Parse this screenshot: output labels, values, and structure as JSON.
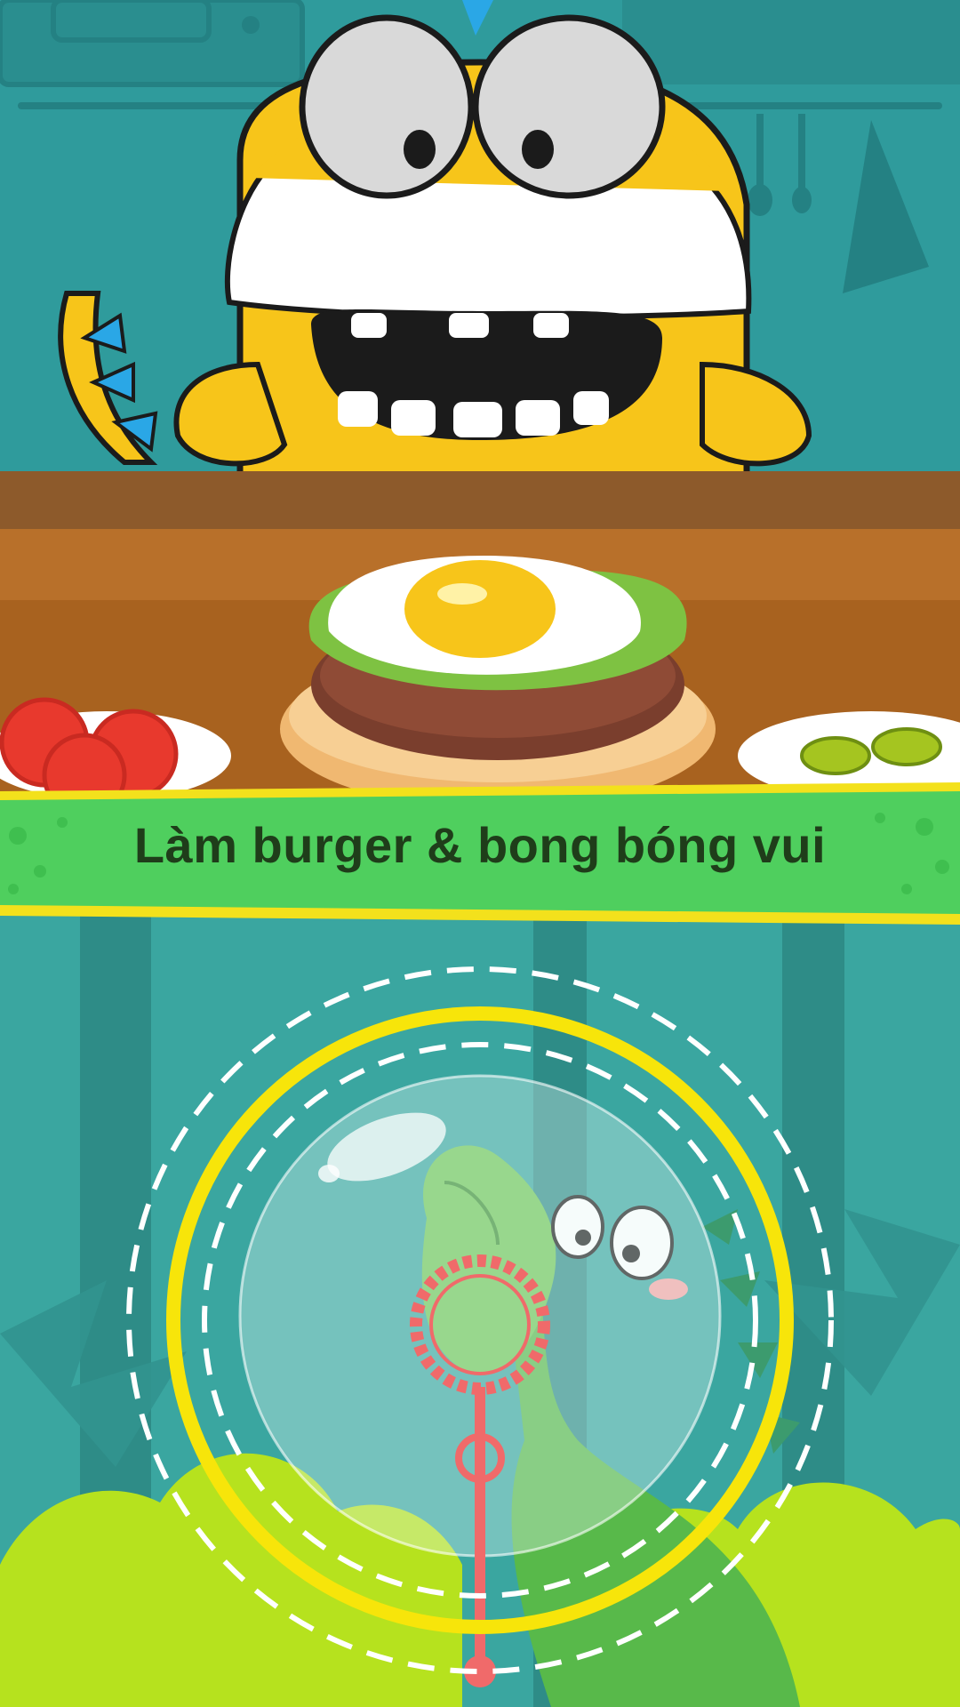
{
  "banner": {
    "caption": "Làm burger & bong bóng vui"
  },
  "colors": {
    "kitchen_wall": "#2f9b9c",
    "monster_yellow": "#f7c51a",
    "counter_wood": "#9b5a22",
    "banner_green": "#4fcf5e",
    "banner_border": "#f3e11c",
    "forest_teal": "#3aa6a0",
    "bubble_ring": "#f7e50a",
    "dino_green": "#58b94a",
    "bubble_wand": "#f06a6a"
  },
  "scenes": [
    {
      "name": "burger-kitchen",
      "icons": [
        "yellow-monster-icon",
        "burger-icon",
        "tomato-plate-icon",
        "pickle-plate-icon"
      ]
    },
    {
      "name": "bubble-forest",
      "icons": [
        "dino-icon",
        "soap-bubble-icon",
        "bubble-wand-icon",
        "target-ring-icon"
      ]
    }
  ]
}
